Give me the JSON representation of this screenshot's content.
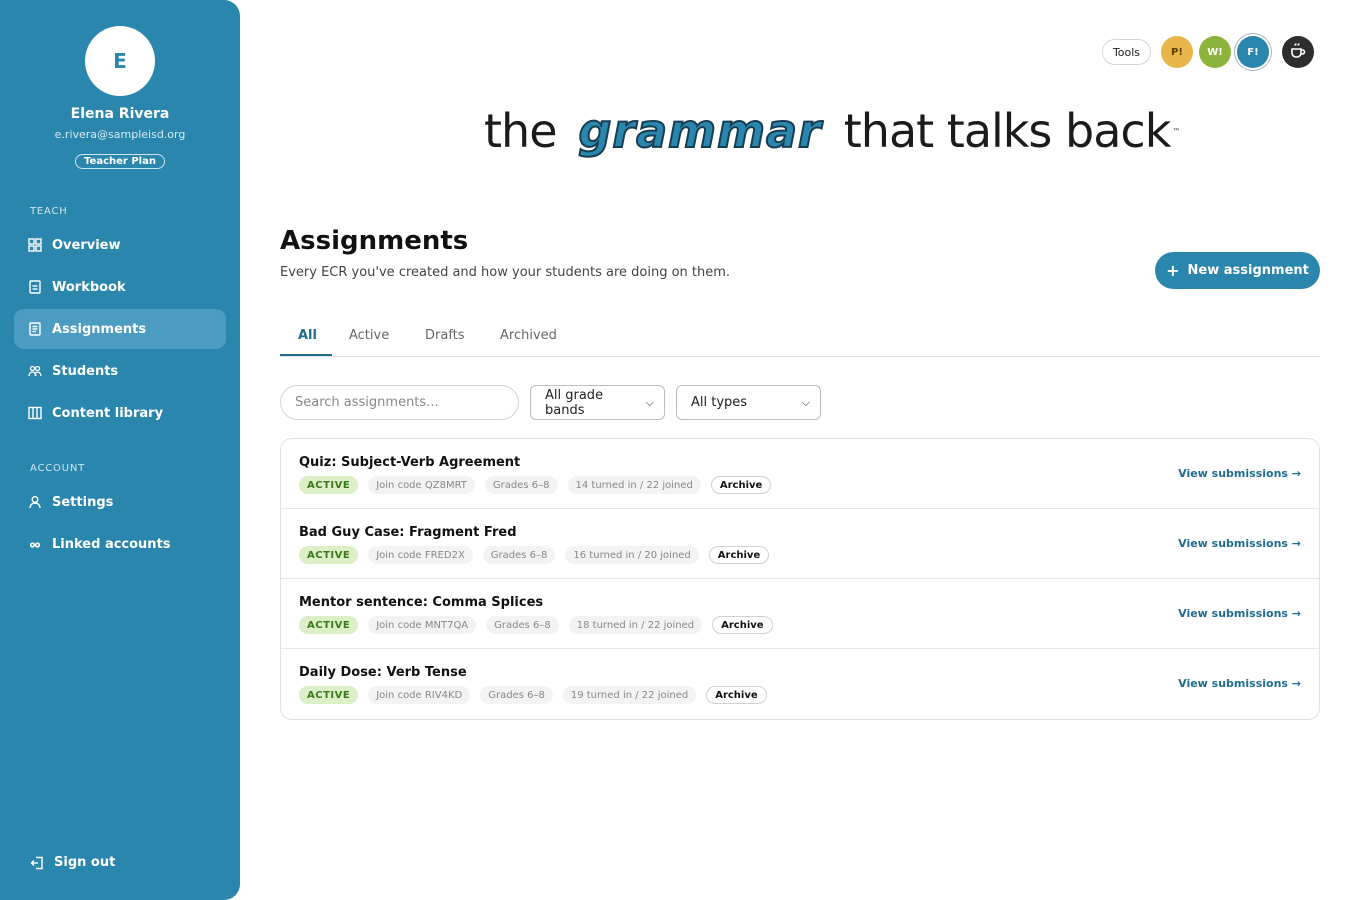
{
  "user": {
    "initial": "E",
    "name": "Elena Rivera",
    "email": "e.rivera@sampleisd.org",
    "plan": "Teacher Plan"
  },
  "sidebar": {
    "teach_label": "TEACH",
    "account_label": "ACCOUNT",
    "teach_items": [
      {
        "label": "Overview",
        "icon": "grid-icon"
      },
      {
        "label": "Workbook",
        "icon": "document-icon"
      },
      {
        "label": "Assignments",
        "icon": "clipboard-icon",
        "active": true
      },
      {
        "label": "Students",
        "icon": "users-icon"
      },
      {
        "label": "Content library",
        "icon": "library-icon"
      }
    ],
    "account_items": [
      {
        "label": "Settings",
        "icon": "person-icon"
      },
      {
        "label": "Linked accounts",
        "icon": "link-icon"
      }
    ],
    "signout_label": "Sign out"
  },
  "topbar": {
    "tools_label": "Tools",
    "badges": [
      "P!",
      "W!",
      "F!"
    ],
    "coffee_icon": "coffee-cup-icon"
  },
  "banner": {
    "prefix": "the",
    "highlight": "grammar",
    "suffix": "that talks back",
    "tm": "™"
  },
  "header": {
    "title": "Assignments",
    "subtitle": "Every ECR you've created and how your students are doing on them.",
    "new_button_label": "New assignment"
  },
  "tabs": [
    "All",
    "Active",
    "Drafts",
    "Archived"
  ],
  "filters": {
    "search_placeholder": "Search assignments...",
    "grade_band_selected": "All grade bands",
    "type_selected": "All types"
  },
  "assignments": [
    {
      "title": "Quiz: Subject-Verb Agreement",
      "status": "ACTIVE",
      "join_code": "Join code QZ8MRT",
      "grades": "Grades 6–8",
      "progress": "14 turned in / 22 joined",
      "archive_label": "Archive",
      "link": "View submissions →"
    },
    {
      "title": "Bad Guy Case: Fragment Fred",
      "status": "ACTIVE",
      "join_code": "Join code FRED2X",
      "grades": "Grades 6–8",
      "progress": "16 turned in / 20 joined",
      "archive_label": "Archive",
      "link": "View submissions →"
    },
    {
      "title": "Mentor sentence: Comma Splices",
      "status": "ACTIVE",
      "join_code": "Join code MNT7QA",
      "grades": "Grades 6–8",
      "progress": "18 turned in / 22 joined",
      "archive_label": "Archive",
      "link": "View submissions →"
    },
    {
      "title": "Daily Dose: Verb Tense",
      "status": "ACTIVE",
      "join_code": "Join code RIV4KD",
      "grades": "Grades 6–8",
      "progress": "19 turned in / 22 joined",
      "archive_label": "Archive",
      "link": "View submissions →"
    }
  ],
  "colors": {
    "sidebar": "#2a86ad",
    "accent": "#1f6c8e",
    "active_badge": "#dcefc7"
  }
}
